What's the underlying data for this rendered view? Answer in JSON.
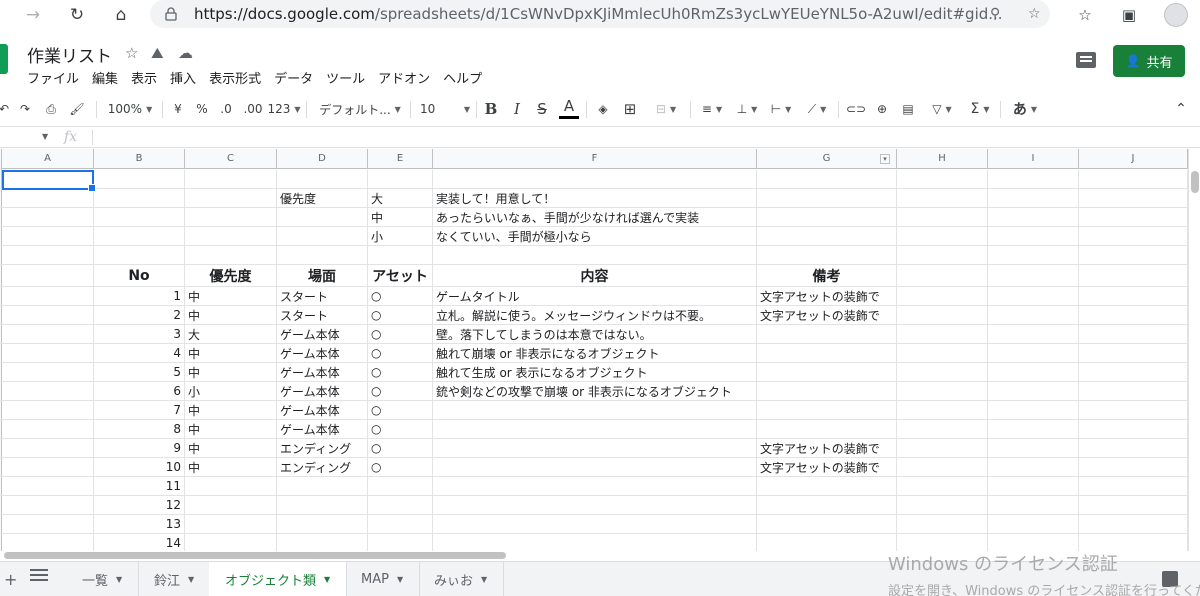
{
  "browser": {
    "url_host": "https://docs.google.com",
    "url_path": "/spreadsheets/d/1CsWNvDpxKJiMmlecUh0RmZs3ycLwYEUeYNL5o-A2uwI/edit#gid..."
  },
  "doc": {
    "title": "作業リスト",
    "menu": [
      "ファイル",
      "編集",
      "表示",
      "挿入",
      "表示形式",
      "データ",
      "ツール",
      "アドオン",
      "ヘルプ"
    ],
    "share_label": "共有"
  },
  "toolbar": {
    "zoom": "100%",
    "currency": "¥",
    "percent": "%",
    "dec_less": ".0",
    "dec_more": ".00",
    "format_more": "123",
    "font": "デフォルト...",
    "font_size": "10",
    "bold": "B",
    "italic": "I",
    "strike": "S",
    "text_color": "A",
    "input_tools": "あ"
  },
  "formula": {
    "fx": "fx"
  },
  "columns": [
    "A",
    "B",
    "C",
    "D",
    "E",
    "F",
    "G",
    "H",
    "I",
    "J"
  ],
  "legend": [
    {
      "label": "優先度",
      "level": "大",
      "desc": "実装して！用意して！"
    },
    {
      "label": "",
      "level": "中",
      "desc": "あったらいいなぁ、手間が少なければ選んで実装"
    },
    {
      "label": "",
      "level": "小",
      "desc": "なくていい、手間が極小なら"
    }
  ],
  "table": {
    "headers": [
      "No",
      "優先度",
      "場面",
      "アセット",
      "内容",
      "備考"
    ],
    "rows": [
      {
        "no": "1",
        "priority": "中",
        "scene": "スタート",
        "asset": "○",
        "content": "ゲームタイトル",
        "note": "文字アセットの装飾で"
      },
      {
        "no": "2",
        "priority": "中",
        "scene": "スタート",
        "asset": "○",
        "content": "立札。解説に使う。メッセージウィンドウは不要。",
        "note": "文字アセットの装飾で"
      },
      {
        "no": "3",
        "priority": "大",
        "scene": "ゲーム本体",
        "asset": "○",
        "content": "壁。落下してしまうのは本意ではない。",
        "note": ""
      },
      {
        "no": "4",
        "priority": "中",
        "scene": "ゲーム本体",
        "asset": "○",
        "content": "触れて崩壊 or 非表示になるオブジェクト",
        "note": ""
      },
      {
        "no": "5",
        "priority": "中",
        "scene": "ゲーム本体",
        "asset": "○",
        "content": "触れて生成 or 表示になるオブジェクト",
        "note": ""
      },
      {
        "no": "6",
        "priority": "小",
        "scene": "ゲーム本体",
        "asset": "○",
        "content": "銃や剣などの攻撃で崩壊 or 非表示になるオブジェクト",
        "note": ""
      },
      {
        "no": "7",
        "priority": "中",
        "scene": "ゲーム本体",
        "asset": "○",
        "content": "",
        "note": ""
      },
      {
        "no": "8",
        "priority": "中",
        "scene": "ゲーム本体",
        "asset": "○",
        "content": "",
        "note": ""
      },
      {
        "no": "9",
        "priority": "中",
        "scene": "エンディング",
        "asset": "○",
        "content": "",
        "note": "文字アセットの装飾で"
      },
      {
        "no": "10",
        "priority": "中",
        "scene": "エンディング",
        "asset": "○",
        "content": "",
        "note": "文字アセットの装飾で"
      },
      {
        "no": "11",
        "priority": "",
        "scene": "",
        "asset": "",
        "content": "",
        "note": ""
      },
      {
        "no": "12",
        "priority": "",
        "scene": "",
        "asset": "",
        "content": "",
        "note": ""
      },
      {
        "no": "13",
        "priority": "",
        "scene": "",
        "asset": "",
        "content": "",
        "note": ""
      },
      {
        "no": "14",
        "priority": "",
        "scene": "",
        "asset": "",
        "content": "",
        "note": ""
      }
    ]
  },
  "sheets": [
    {
      "name": "一覧",
      "active": false
    },
    {
      "name": "鈴江",
      "active": false
    },
    {
      "name": "オブジェクト類",
      "active": true
    },
    {
      "name": "MAP",
      "active": false
    },
    {
      "name": "みぃお",
      "active": false
    }
  ],
  "watermark": {
    "line1": "Windows のライセンス認証",
    "line2": "設定を開き、Windows のライセンス認証を行ってください"
  },
  "colors": {
    "accent": "#188038",
    "selection": "#1a73e8"
  }
}
